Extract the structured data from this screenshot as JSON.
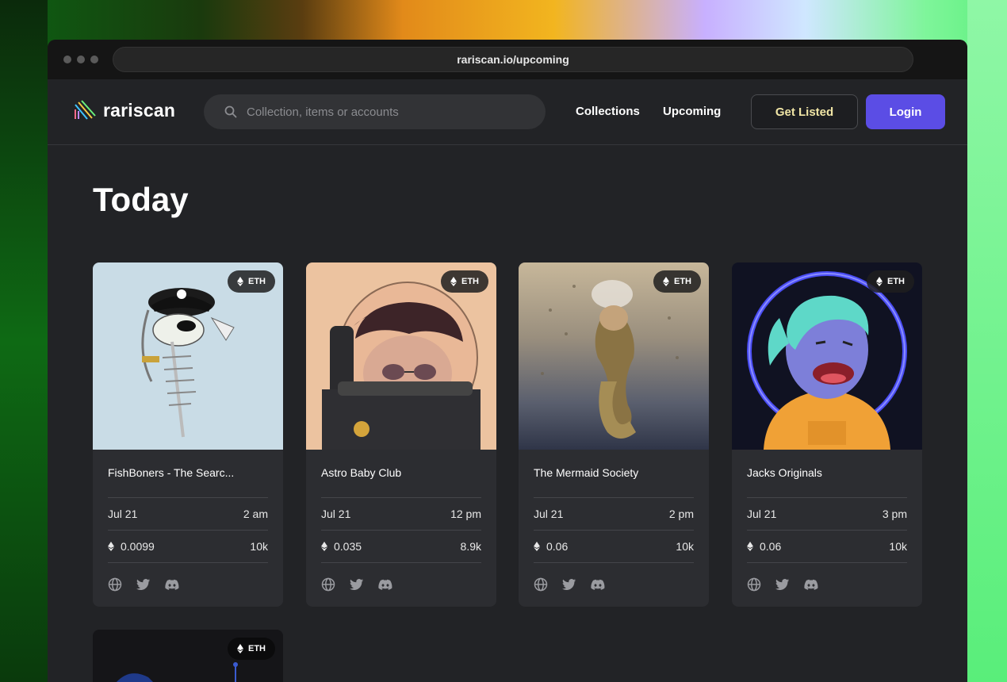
{
  "browser": {
    "url": "rariscan.io/upcoming"
  },
  "brand": {
    "name": "rariscan"
  },
  "search": {
    "placeholder": "Collection, items or accounts"
  },
  "nav": {
    "collections": "Collections",
    "upcoming": "Upcoming",
    "get_listed": "Get Listed",
    "login": "Login"
  },
  "page": {
    "heading": "Today"
  },
  "colors": {
    "accent": "#5b4de5",
    "get_listed_text": "#f1e6a6",
    "background": "#222326",
    "card": "#2c2d31"
  },
  "cards": [
    {
      "name": "FishBoners - The Searc...",
      "chain": "ETH",
      "date": "Jul 21",
      "time": "2 am",
      "price": "0.0099",
      "supply": "10k"
    },
    {
      "name": "Astro Baby Club",
      "chain": "ETH",
      "date": "Jul 21",
      "time": "12 pm",
      "price": "0.035",
      "supply": "8.9k"
    },
    {
      "name": "The Mermaid Society",
      "chain": "ETH",
      "date": "Jul 21",
      "time": "2 pm",
      "price": "0.06",
      "supply": "10k"
    },
    {
      "name": "Jacks Originals",
      "chain": "ETH",
      "date": "Jul 21",
      "time": "3 pm",
      "price": "0.06",
      "supply": "10k"
    },
    {
      "chain": "ETH"
    }
  ],
  "icons": {
    "social": [
      "globe-icon",
      "twitter-icon",
      "discord-icon"
    ],
    "currency": "eth-icon"
  }
}
